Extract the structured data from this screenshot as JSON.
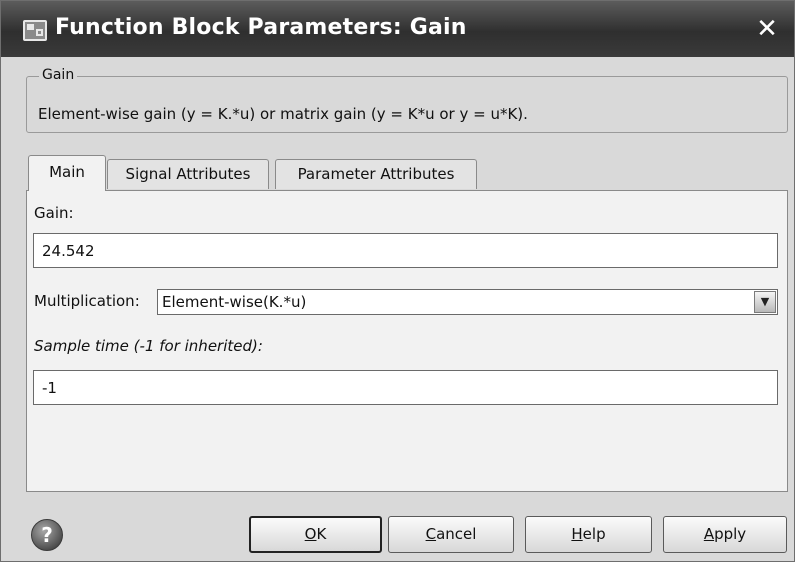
{
  "window": {
    "title": "Function Block Parameters: Gain",
    "close_glyph": "✕",
    "icon": "block-parameters-icon"
  },
  "block_group": {
    "legend": "Gain",
    "description": "Element-wise gain (y = K.*u) or matrix gain (y = K*u or y = u*K)."
  },
  "tabs": [
    {
      "label": "Main",
      "active": true
    },
    {
      "label": "Signal Attributes",
      "active": false
    },
    {
      "label": "Parameter Attributes",
      "active": false
    }
  ],
  "main": {
    "gain_label": "Gain:",
    "gain_value": "24.542",
    "multiplication_label": "Multiplication:",
    "multiplication_value": "Element-wise(K.*u)",
    "sample_time_label": "Sample time (-1 for inherited):",
    "sample_time_value": "-1"
  },
  "buttons": {
    "ok_mnemonic": "O",
    "ok_rest": "K",
    "cancel_mnemonic": "C",
    "cancel_rest": "ancel",
    "help_mnemonic": "H",
    "help_rest": "elp",
    "apply_mnemonic": "A",
    "apply_rest": "pply",
    "help_icon_glyph": "?"
  },
  "colors": {
    "titlebar": "#3a3a3a",
    "dialog_bg": "#d9d9d9",
    "panel_bg": "#f2f2f2"
  }
}
